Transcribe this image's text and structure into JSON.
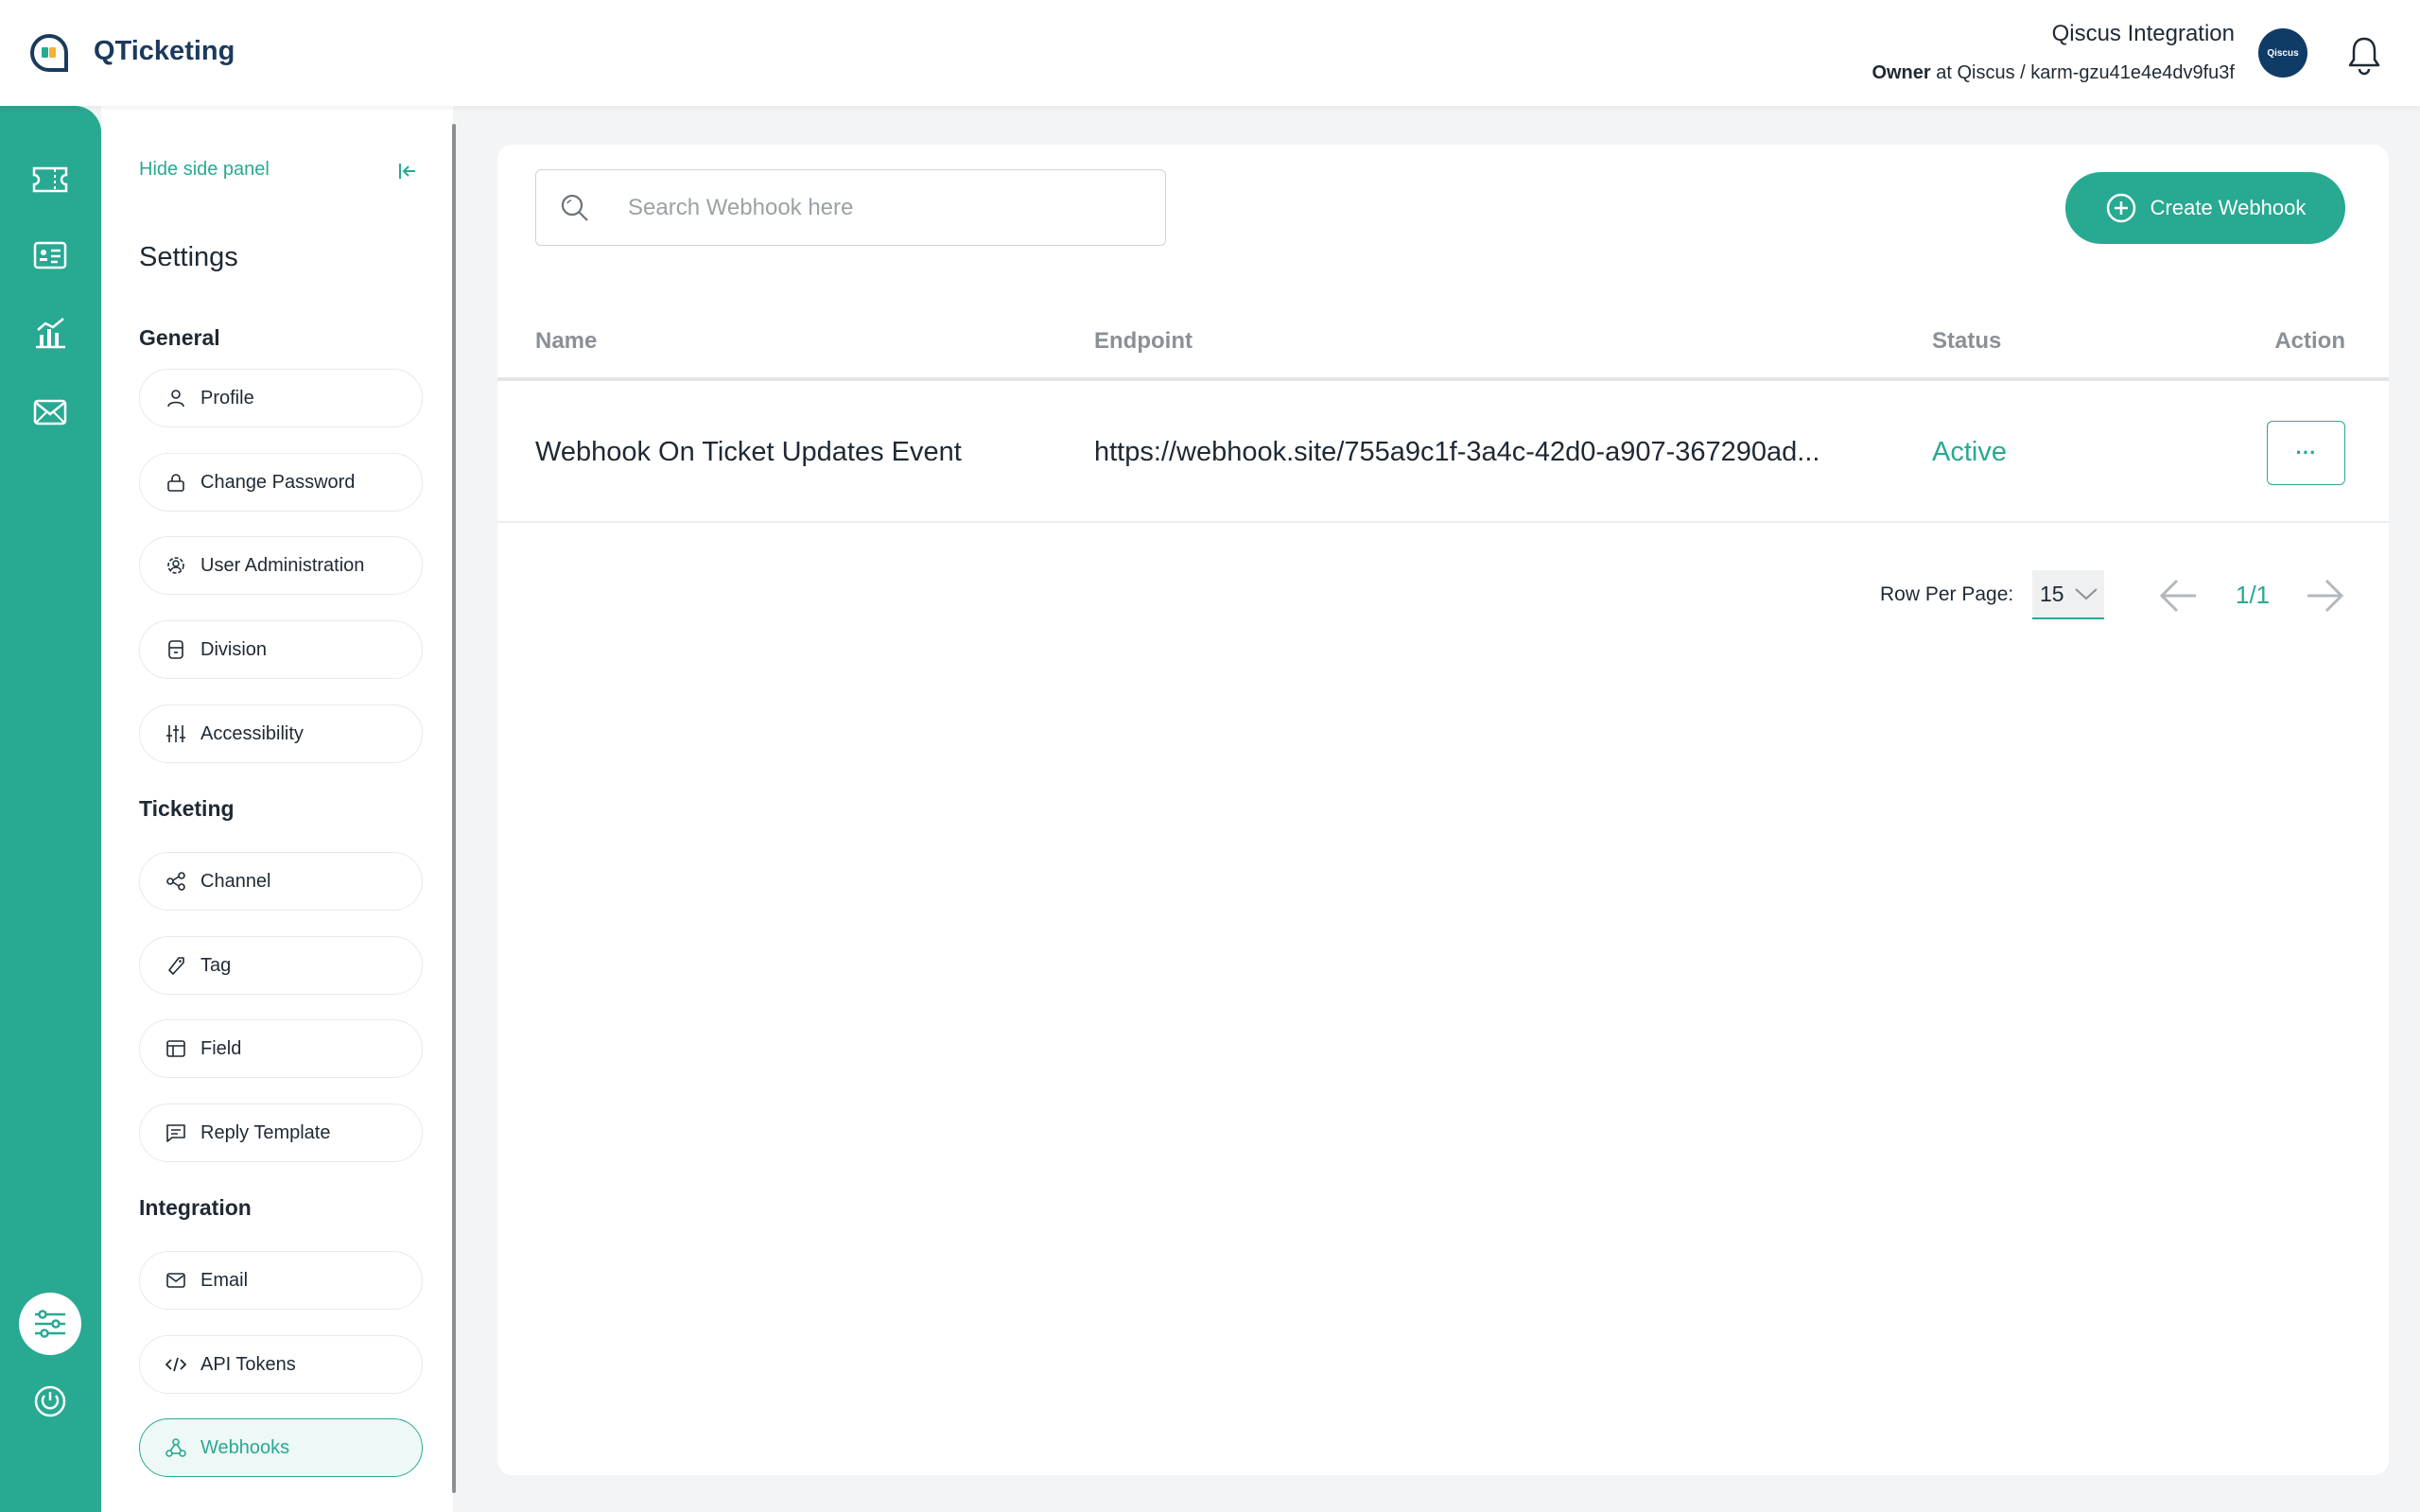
{
  "header": {
    "app_name": "QTicketing",
    "account_name": "Qiscus Integration",
    "role": "Owner",
    "role_connector": "at",
    "org": "Qiscus / karm-gzu41e4e4dv9fu3f",
    "avatar_text": "Qiscus"
  },
  "rail": {
    "icons": [
      "ticket-icon",
      "contact-card-icon",
      "analytics-icon",
      "mail-icon",
      "settings-sliders-icon",
      "power-icon"
    ]
  },
  "side_panel": {
    "hide_label": "Hide side panel",
    "title": "Settings",
    "sections": [
      {
        "title": "General",
        "items": [
          "Profile",
          "Change Password",
          "User Administration",
          "Division",
          "Accessibility"
        ]
      },
      {
        "title": "Ticketing",
        "items": [
          "Channel",
          "Tag",
          "Field",
          "Reply Template"
        ]
      },
      {
        "title": "Integration",
        "items": [
          "Email",
          "API Tokens",
          "Webhooks"
        ]
      }
    ],
    "active_item": "Webhooks"
  },
  "main": {
    "search_placeholder": "Search Webhook here",
    "create_label": "Create Webhook",
    "columns": [
      "Name",
      "Endpoint",
      "Status",
      "Action"
    ],
    "rows": [
      {
        "name": "Webhook On Ticket Updates Event",
        "endpoint": "https://webhook.site/755a9c1f-3a4c-42d0-a907-367290ad...",
        "status": "Active",
        "action": "···"
      }
    ],
    "pagination": {
      "rows_per_page_label": "Row Per Page:",
      "rows_per_page_value": "15",
      "page_indicator": "1/1"
    }
  },
  "colors": {
    "brand": "#28a992",
    "header_text": "#1b3a5c",
    "avatar": "#0f3c66"
  }
}
